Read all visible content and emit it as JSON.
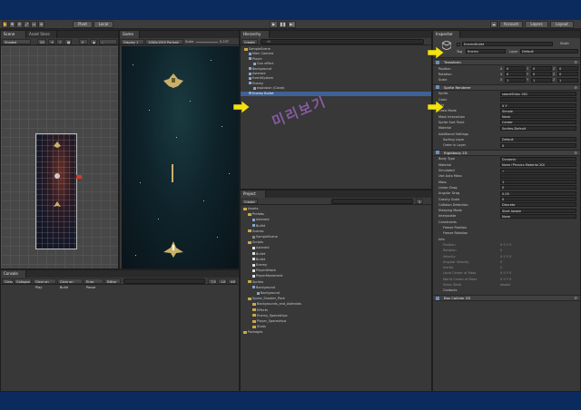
{
  "toolbar": {
    "pivot": "Pivot",
    "local": "Local",
    "play": "▶",
    "pause": "❚❚",
    "step": "▶|",
    "account": "Account",
    "layers": "Layers",
    "layout": "Layout"
  },
  "scene_panel": {
    "tabs": [
      "Scene",
      "Asset Store"
    ],
    "shading": "Shaded",
    "mode_2d": "2D"
  },
  "game_panel": {
    "tab": "Game",
    "display": "Display 1",
    "aspect": "1080x1920 Portrait (1080x1920)",
    "scale_label": "Scale",
    "scale_value": "0.237",
    "maximize": "Maximize On Play"
  },
  "hierarchy": {
    "tab": "Hierarchy",
    "create": "Create",
    "search_placeholder": "All",
    "items": [
      {
        "label": "SampleScene",
        "indent": 0,
        "type": "scene"
      },
      {
        "label": "Main Camera",
        "indent": 1,
        "type": "object"
      },
      {
        "label": "Player",
        "indent": 1,
        "type": "object"
      },
      {
        "label": "Gun effect",
        "indent": 2,
        "type": "object"
      },
      {
        "label": "Background",
        "indent": 1,
        "type": "object"
      },
      {
        "label": "Asteroid",
        "indent": 1,
        "type": "object"
      },
      {
        "label": "EventSystem",
        "indent": 1,
        "type": "object"
      },
      {
        "label": "Enemy",
        "indent": 1,
        "type": "object"
      },
      {
        "label": "explosion (Clone)",
        "indent": 2,
        "type": "object"
      },
      {
        "label": "Enemy Bullet",
        "indent": 1,
        "type": "object",
        "selected": true
      }
    ]
  },
  "console": {
    "tab": "Console",
    "buttons": [
      "Clear",
      "Collapse",
      "Clear on Play",
      "Clear on Build",
      "Error Pause",
      "Editor"
    ]
  },
  "project": {
    "tab": "Project",
    "create": "Create",
    "items": [
      {
        "label": "Assets",
        "indent": 0
      },
      {
        "label": "Prefabs",
        "indent": 1
      },
      {
        "label": "Asteroid",
        "indent": 2,
        "icon": "prefab"
      },
      {
        "label": "Bullet",
        "indent": 2,
        "icon": "prefab"
      },
      {
        "label": "Scenes",
        "indent": 1
      },
      {
        "label": "SampleScene",
        "indent": 2,
        "icon": "scene"
      },
      {
        "label": "Scripts",
        "indent": 1
      },
      {
        "label": "Asteroid",
        "indent": 2,
        "icon": "script"
      },
      {
        "label": "Bullet",
        "indent": 2,
        "icon": "script"
      },
      {
        "label": "Bullet",
        "indent": 2,
        "icon": "script"
      },
      {
        "label": "Enemy",
        "indent": 2,
        "icon": "script"
      },
      {
        "label": "PlayerAttack",
        "indent": 2,
        "icon": "script"
      },
      {
        "label": "PlayerMovement",
        "indent": 2,
        "icon": "script"
      },
      {
        "label": "Sprites",
        "indent": 1
      },
      {
        "label": "Background",
        "indent": 2,
        "icon": "sprite"
      },
      {
        "label": "Background",
        "indent": 3,
        "icon": "sprite"
      },
      {
        "label": "Space_Shooter_Pack",
        "indent": 1
      },
      {
        "label": "Backgrounds_and_Asteroids",
        "indent": 2
      },
      {
        "label": "Effects",
        "indent": 2
      },
      {
        "label": "Enemy_Spaceships",
        "indent": 2
      },
      {
        "label": "Player_Spaceships",
        "indent": 2
      },
      {
        "label": "Shots",
        "indent": 2
      },
      {
        "label": "Packages",
        "indent": 0
      }
    ]
  },
  "inspector": {
    "tab": "Inspector",
    "object_name": "EnemyBullet",
    "static": "Static",
    "tag_label": "Tag",
    "tag_value": "Enemy",
    "layer_label": "Layer",
    "layer_value": "Default",
    "transform": {
      "title": "Transform",
      "rows": [
        {
          "label": "Position",
          "x": "0",
          "y": "0",
          "z": "0"
        },
        {
          "label": "Rotation",
          "x": "0",
          "y": "0",
          "z": "0"
        },
        {
          "label": "Scale",
          "x": "1",
          "y": "1",
          "z": "1"
        }
      ]
    },
    "sprite_renderer": {
      "title": "Sprite Renderer",
      "rows": [
        {
          "label": "Sprite",
          "value": "spaceShips_001"
        },
        {
          "label": "Color",
          "value": ""
        },
        {
          "label": "Flip",
          "value": "X  Y"
        },
        {
          "label": "Draw Mode",
          "value": "Simple"
        },
        {
          "label": "Mask Interaction",
          "value": "None"
        },
        {
          "label": "Sprite Sort Point",
          "value": "Center"
        },
        {
          "label": "Material",
          "value": "Sprites-Default"
        }
      ],
      "additional": "Additional Settings",
      "sorting_rows": [
        {
          "label": "Sorting Layer",
          "value": "Default"
        },
        {
          "label": "Order in Layer",
          "value": "0"
        }
      ]
    },
    "rigidbody": {
      "title": "Rigidbody 2D",
      "rows": [
        {
          "label": "Body Type",
          "value": "Dynamic"
        },
        {
          "label": "Material",
          "value": "None (Physics Material 2D)"
        },
        {
          "label": "Simulated",
          "value": "✓"
        },
        {
          "label": "Use Auto Mass",
          "value": ""
        },
        {
          "label": "Mass",
          "value": "1"
        },
        {
          "label": "Linear Drag",
          "value": "0"
        },
        {
          "label": "Angular Drag",
          "value": "0.05"
        },
        {
          "label": "Gravity Scale",
          "value": "0"
        },
        {
          "label": "Collision Detection",
          "value": "Discrete"
        },
        {
          "label": "Sleeping Mode",
          "value": "Start Awake"
        },
        {
          "label": "Interpolate",
          "value": "None"
        }
      ],
      "constraints": "Constraints",
      "freeze_pos": "Freeze Position",
      "freeze_rot": "Freeze Rotation",
      "info": "Info",
      "info_rows": [
        {
          "label": "Position",
          "value": "X 0    Y 0"
        },
        {
          "label": "Rotation",
          "value": "0"
        },
        {
          "label": "Velocity",
          "value": "X 0    Y 0"
        },
        {
          "label": "Angular Velocity",
          "value": "0"
        },
        {
          "label": "Inertia",
          "value": "0"
        },
        {
          "label": "Local Center of Mass",
          "value": "X 0    Y 0"
        },
        {
          "label": "World Center of Mass",
          "value": "X 0    Y 0"
        },
        {
          "label": "Sleep State",
          "value": "Awake"
        }
      ],
      "contacts": "Contacts"
    },
    "box_collider": {
      "title": "Box Collider 2D"
    }
  },
  "watermark": "미리보기"
}
